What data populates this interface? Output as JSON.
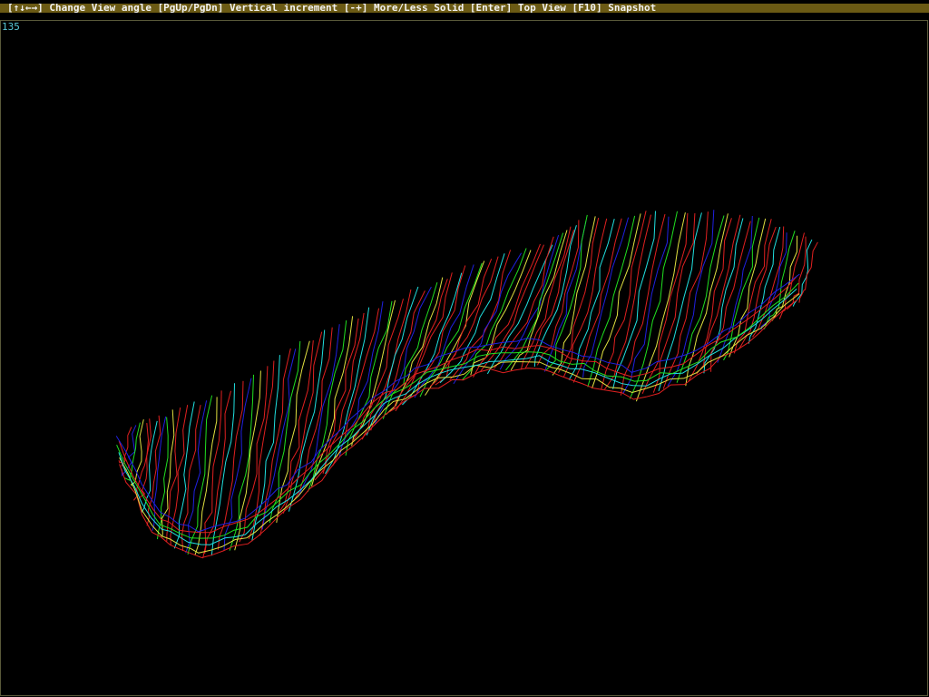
{
  "help_bar": {
    "text": "[↑↓←→] Change View angle [PgUp/PgDn] Vertical increment [-+] More/Less Solid [Enter] Top View [F10] Snapshot"
  },
  "viewport": {
    "angle_readout": "135"
  },
  "colors": {
    "help_bar_bg": "#6b5a14",
    "help_bar_text": "#f2f2f2",
    "angle_text": "#58c8d8",
    "wire_colors": [
      "#e02020",
      "#2020e0",
      "#20e020",
      "#e0e040",
      "#e02020",
      "#e02020",
      "#20e0e0"
    ]
  },
  "icons": {
    "surface": "wireframe-terrain-icon"
  }
}
